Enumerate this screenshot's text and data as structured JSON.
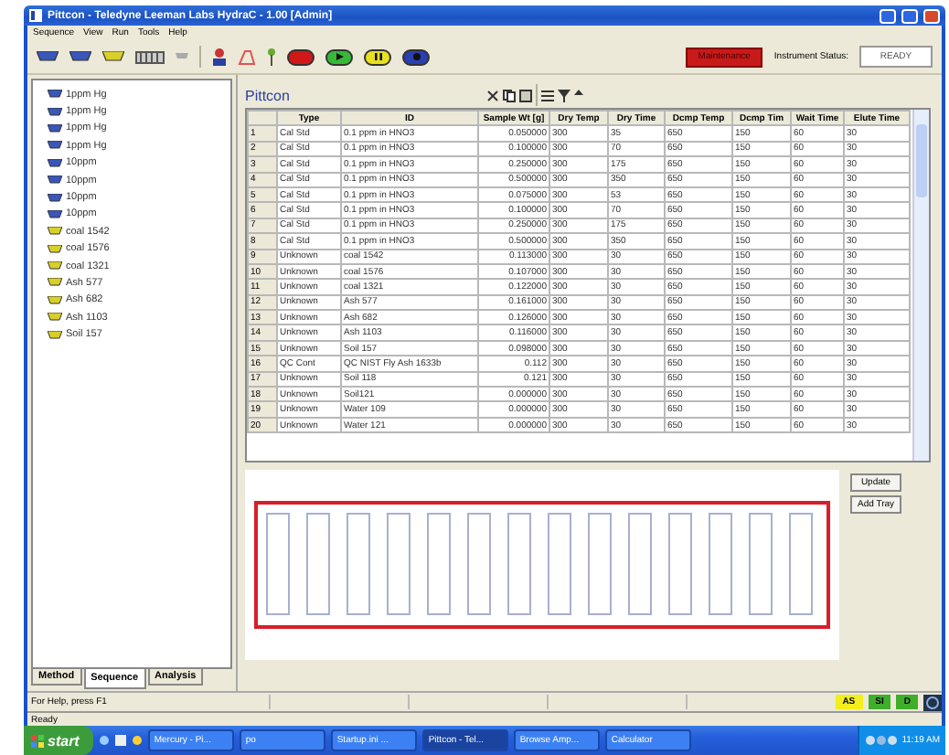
{
  "window": {
    "title": "Pittcon - Teledyne Leeman Labs HydraC - 1.00 [Admin]"
  },
  "menu": [
    "Sequence",
    "View",
    "Run",
    "Tools",
    "Help"
  ],
  "toolbar": {
    "alert_button": "Maintenance",
    "status_label": "Instrument Status:",
    "status_value": "READY"
  },
  "sidebar": {
    "items": [
      {
        "label": "1ppm Hg",
        "kind": "standard"
      },
      {
        "label": "1ppm Hg",
        "kind": "standard"
      },
      {
        "label": "1ppm Hg",
        "kind": "standard"
      },
      {
        "label": "1ppm Hg",
        "kind": "standard"
      },
      {
        "label": "10ppm",
        "kind": "standard"
      },
      {
        "label": "10ppm",
        "kind": "standard"
      },
      {
        "label": "10ppm",
        "kind": "standard"
      },
      {
        "label": "10ppm",
        "kind": "standard"
      },
      {
        "label": "coal 1542",
        "kind": "sample"
      },
      {
        "label": "coal 1576",
        "kind": "sample"
      },
      {
        "label": "coal 1321",
        "kind": "sample"
      },
      {
        "label": "Ash 577",
        "kind": "sample"
      },
      {
        "label": "Ash 682",
        "kind": "sample"
      },
      {
        "label": "Ash 1103",
        "kind": "sample"
      },
      {
        "label": "Soil 157",
        "kind": "sample"
      }
    ],
    "tabs": [
      {
        "label": "Method",
        "selected": false
      },
      {
        "label": "Sequence",
        "selected": true
      },
      {
        "label": "Analysis",
        "selected": false
      }
    ]
  },
  "sequence": {
    "title": "Pittcon",
    "table": {
      "columns": [
        "",
        "Type",
        "ID",
        "Sample Wt [g]",
        "Dry Temp",
        "Dry Time",
        "Dcmp Temp",
        "Dcmp Tim",
        "Wait Time",
        "Elute Time"
      ],
      "rows": [
        [
          "1",
          "Cal Std",
          "0.1 ppm in HNO3",
          "0.050000",
          "300",
          "35",
          "650",
          "150",
          "60",
          "30"
        ],
        [
          "2",
          "Cal Std",
          "0.1 ppm in HNO3",
          "0.100000",
          "300",
          "70",
          "650",
          "150",
          "60",
          "30"
        ],
        [
          "3",
          "Cal Std",
          "0.1 ppm in HNO3",
          "0.250000",
          "300",
          "175",
          "650",
          "150",
          "60",
          "30"
        ],
        [
          "4",
          "Cal Std",
          "0.1 ppm in HNO3",
          "0.500000",
          "300",
          "350",
          "650",
          "150",
          "60",
          "30"
        ],
        [
          "5",
          "Cal Std",
          "0.1 ppm in HNO3",
          "0.075000",
          "300",
          "53",
          "650",
          "150",
          "60",
          "30"
        ],
        [
          "6",
          "Cal Std",
          "0.1 ppm in HNO3",
          "0.100000",
          "300",
          "70",
          "650",
          "150",
          "60",
          "30"
        ],
        [
          "7",
          "Cal Std",
          "0.1 ppm in HNO3",
          "0.250000",
          "300",
          "175",
          "650",
          "150",
          "60",
          "30"
        ],
        [
          "8",
          "Cal Std",
          "0.1 ppm in HNO3",
          "0.500000",
          "300",
          "350",
          "650",
          "150",
          "60",
          "30"
        ],
        [
          "9",
          "Unknown",
          "coal 1542",
          "0.113000",
          "300",
          "30",
          "650",
          "150",
          "60",
          "30"
        ],
        [
          "10",
          "Unknown",
          "coal 1576",
          "0.107000",
          "300",
          "30",
          "650",
          "150",
          "60",
          "30"
        ],
        [
          "11",
          "Unknown",
          "coal 1321",
          "0.122000",
          "300",
          "30",
          "650",
          "150",
          "60",
          "30"
        ],
        [
          "12",
          "Unknown",
          "Ash 577",
          "0.161000",
          "300",
          "30",
          "650",
          "150",
          "60",
          "30"
        ],
        [
          "13",
          "Unknown",
          "Ash 682",
          "0.126000",
          "300",
          "30",
          "650",
          "150",
          "60",
          "30"
        ],
        [
          "14",
          "Unknown",
          "Ash 1103",
          "0.116000",
          "300",
          "30",
          "650",
          "150",
          "60",
          "30"
        ],
        [
          "15",
          "Unknown",
          "Soil 157",
          "0.098000",
          "300",
          "30",
          "650",
          "150",
          "60",
          "30"
        ],
        [
          "16",
          "QC Cont",
          "QC NIST Fly Ash 1633b",
          "0.112",
          "300",
          "30",
          "650",
          "150",
          "60",
          "30"
        ],
        [
          "17",
          "Unknown",
          "Soil 118",
          "0.121",
          "300",
          "30",
          "650",
          "150",
          "60",
          "30"
        ],
        [
          "18",
          "Unknown",
          "Soil121",
          "0.000000",
          "300",
          "30",
          "650",
          "150",
          "60",
          "30"
        ],
        [
          "19",
          "Unknown",
          "Water 109",
          "0.000000",
          "300",
          "30",
          "650",
          "150",
          "60",
          "30"
        ],
        [
          "20",
          "Unknown",
          "Water 121",
          "0.000000",
          "300",
          "30",
          "650",
          "150",
          "60",
          "30"
        ]
      ]
    },
    "tray_buttons": [
      "Update",
      "Add Tray"
    ]
  },
  "status_bar": {
    "help": "For Help, press F1",
    "indicators": [
      {
        "label": "AS",
        "color": "#f2ef1c"
      },
      {
        "label": "SI",
        "color": "#3fae2a"
      },
      {
        "label": "D",
        "color": "#3fae2a"
      }
    ],
    "message": "Ready"
  },
  "taskbar": {
    "start": "start",
    "tasks": [
      {
        "label": "Mercury - Pi...",
        "selected": false
      },
      {
        "label": "po",
        "selected": false
      },
      {
        "label": "Startup.ini ...",
        "selected": false
      },
      {
        "label": "Pittcon - Tel...",
        "selected": true
      },
      {
        "label": "Browse Amp...",
        "selected": false
      },
      {
        "label": "Calculator",
        "selected": false
      }
    ],
    "clock": "11:19 AM"
  }
}
